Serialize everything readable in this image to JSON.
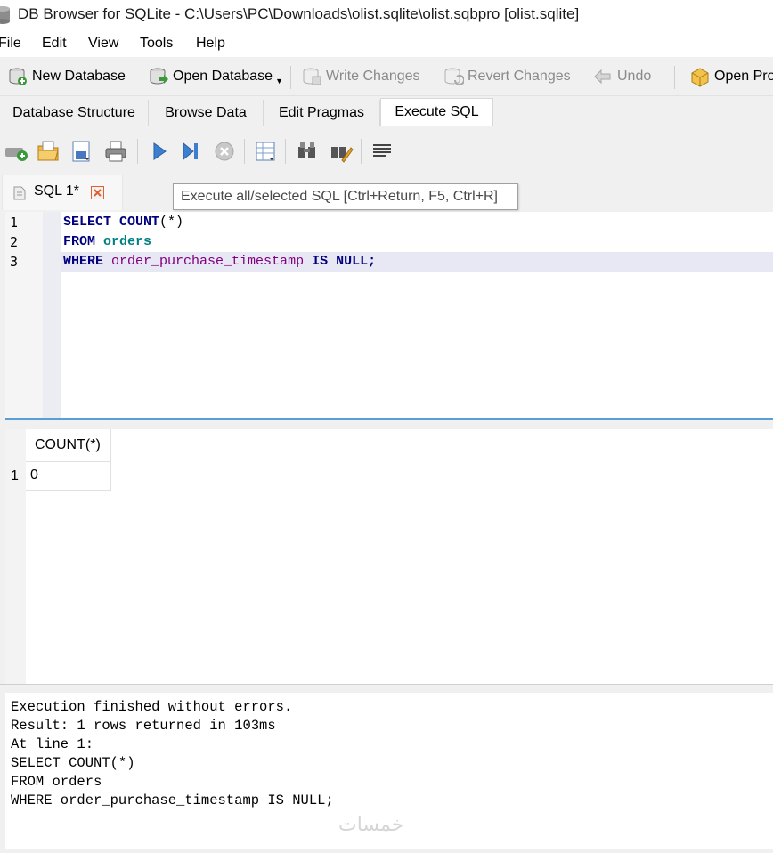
{
  "window": {
    "title": "DB Browser for SQLite - C:\\Users\\PC\\Downloads\\olist.sqlite\\olist.sqbpro [olist.sqlite]"
  },
  "menu": [
    "File",
    "Edit",
    "View",
    "Tools",
    "Help"
  ],
  "toolbar": {
    "new_database": "New Database",
    "open_database": "Open Database",
    "write_changes": "Write Changes",
    "revert_changes": "Revert Changes",
    "undo": "Undo",
    "open_project": "Open Pro"
  },
  "tabs": [
    "Database Structure",
    "Browse Data",
    "Edit Pragmas",
    "Execute SQL"
  ],
  "active_tab": "Execute SQL",
  "sql_tab": {
    "label": "SQL 1*"
  },
  "tooltip": "Execute all/selected SQL [Ctrl+Return, F5, Ctrl+R]",
  "editor": {
    "line_numbers": [
      "1",
      "2",
      "3"
    ],
    "line1": {
      "kw": "SELECT",
      "fn": "COUNT",
      "rest": "(*)"
    },
    "line2": {
      "kw": "FROM",
      "table": "orders"
    },
    "line3": {
      "kw": "WHERE",
      "column": "order_purchase_timestamp",
      "is": "IS",
      "null": "NULL",
      "end": ";"
    }
  },
  "results": {
    "columns": [
      "COUNT(*)"
    ],
    "rows": [
      {
        "row_number": "1",
        "values": [
          "0"
        ]
      }
    ]
  },
  "log": [
    "Execution finished without errors.",
    "Result: 1 rows returned in 103ms",
    "At line 1:",
    "SELECT COUNT(*)",
    "FROM orders",
    "WHERE order_purchase_timestamp IS NULL;"
  ],
  "watermark": "خمسات"
}
